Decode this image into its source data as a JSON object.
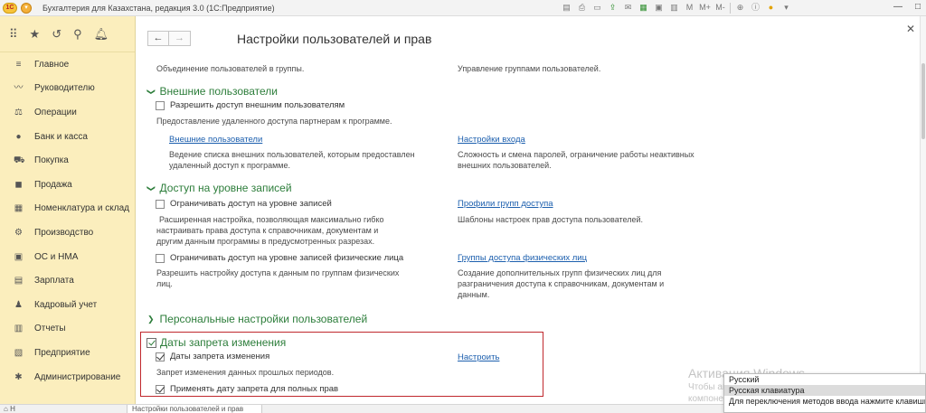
{
  "window": {
    "logo": "1С",
    "title": "Бухгалтерия для Казахстана, редакция 3.0  (1С:Предприятие)",
    "tools": [
      "M",
      "M+",
      "M-"
    ]
  },
  "sidebar": {
    "items": [
      {
        "label": "Главное",
        "icon": "menu-lines-icon"
      },
      {
        "label": "Руководителю",
        "icon": "trend-icon"
      },
      {
        "label": "Операции",
        "icon": "operations-icon"
      },
      {
        "label": "Банк и касса",
        "icon": "coin-icon"
      },
      {
        "label": "Покупка",
        "icon": "cart-icon"
      },
      {
        "label": "Продажа",
        "icon": "shopping-bag-icon"
      },
      {
        "label": "Номенклатура и склад",
        "icon": "warehouse-icon"
      },
      {
        "label": "Производство",
        "icon": "factory-icon"
      },
      {
        "label": "ОС и НМА",
        "icon": "assets-icon"
      },
      {
        "label": "Зарплата",
        "icon": "salary-icon"
      },
      {
        "label": "Кадровый учет",
        "icon": "person-icon"
      },
      {
        "label": "Отчеты",
        "icon": "chart-icon"
      },
      {
        "label": "Предприятие",
        "icon": "enterprise-icon"
      },
      {
        "label": "Администрирование",
        "icon": "gear-icon"
      }
    ]
  },
  "main": {
    "title": "Настройки пользователей и прав",
    "top_left_desc": "Объединение пользователей в группы.",
    "top_right_desc": "Управление группами пользователей.",
    "external": {
      "title": "Внешние пользователи",
      "checkbox_label": "Разрешить доступ внешним пользователям",
      "checkbox_desc": "Предоставление удаленного доступа партнерам к программе.",
      "link_left": "Внешние пользователи",
      "desc_left_1": "Ведение списка внешних пользователей, которым предоставлен",
      "desc_left_2": "удаленный доступ к программе.",
      "link_right": "Настройки входа",
      "desc_right_1": "Сложность и смена паролей, ограничение работы неактивных",
      "desc_right_2": "внешних пользователей."
    },
    "record_access": {
      "title": "Доступ на уровне записей",
      "checkbox1_label": "Ограничивать доступ на уровне записей",
      "checkbox1_desc_1": "Расширенная настройка, позволяющая максимально гибко",
      "checkbox1_desc_2": "настраивать права доступа к справочникам, документам и",
      "checkbox1_desc_3": "другим данным программы в предусмотренных разрезах.",
      "link_right1": "Профили групп доступа",
      "desc_right1": "Шаблоны настроек прав доступа пользователей.",
      "checkbox2_label": "Ограничивать доступ на уровне записей физические лица",
      "checkbox2_desc_1": "Разрешить настройку доступа к данным по группам физических",
      "checkbox2_desc_2": "лиц.",
      "link_right2": "Группы доступа физических лиц",
      "desc_right2_1": "Создание дополнительных групп физических лиц для",
      "desc_right2_2": "разграничения доступа к справочникам, документам и",
      "desc_right2_3": "данным."
    },
    "personal": {
      "title": "Персональные настройки пользователей"
    },
    "lock_dates": {
      "title": "Даты запрета изменения",
      "checkbox1_label": "Даты запрета изменения",
      "link": "Настроить",
      "desc": "Запрет изменения данных прошлых периодов.",
      "checkbox2_label": "Применять дату запрета для полных прав"
    }
  },
  "watermark": {
    "line1": "Активация Windows",
    "line2": "Чтобы активировать Windows, перейдите в",
    "line3": "компонент панели управления \"Система\"."
  },
  "lang_popup": {
    "lang": "Русский",
    "keyboard": "Русская клавиатура",
    "hint": "Для переключения методов ввода нажмите клавиши"
  },
  "bottombar": {
    "left": "Н",
    "tab": "Настройки пользователей и прав"
  },
  "colors": {
    "sidebar_bg": "#fbeebd",
    "section_title": "#2c7d3a",
    "link": "#1c5fae",
    "highlight_border": "#c0282d"
  }
}
